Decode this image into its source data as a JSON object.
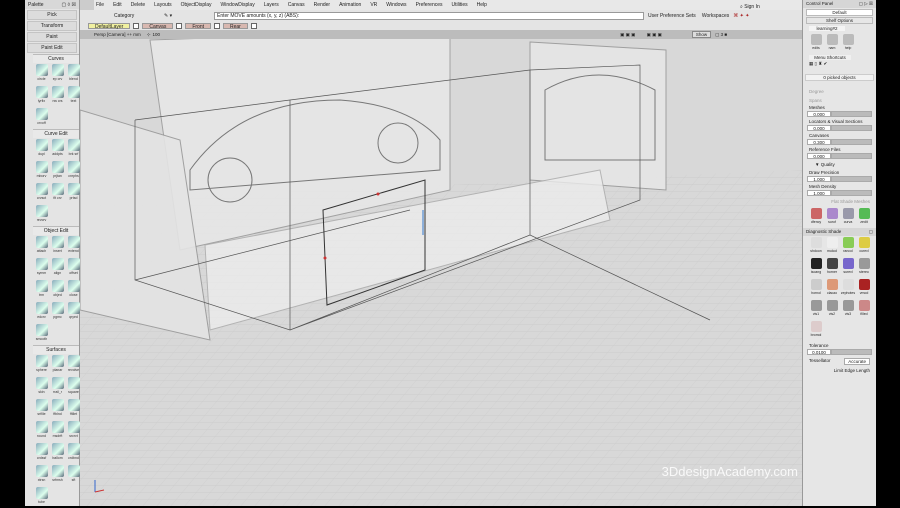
{
  "menu": [
    "File",
    "Edit",
    "Delete",
    "Layouts",
    "ObjectDisplay",
    "WindowDisplay",
    "Layers",
    "Canvas",
    "Render",
    "Animation",
    "VR",
    "Windows",
    "Preferences",
    "Utilities",
    "Help"
  ],
  "toolbar": {
    "category": "Category",
    "prompt": "Enter MOVE amounts (x, y, z) (ABS):",
    "user_pref": "User Preference Sets",
    "workspaces": "Workspaces",
    "sign_in": "Sign In",
    "move_label": "move"
  },
  "layers": [
    "DefaultLayer",
    "Canvas",
    "Front",
    "Rear"
  ],
  "viewport": {
    "label": "Persp [Camera]  ++ mm",
    "zoom": "100",
    "show": "Show",
    "watermark": "3DdesignAcademy.com"
  },
  "palette": {
    "title": "Palette",
    "buttons": [
      "Pick",
      "Transform",
      "Paint",
      "Paint Edit"
    ],
    "sections": [
      {
        "title": "Curves",
        "tools": [
          "circle",
          "ep crv",
          "blend",
          "lyrfix",
          "nw crs",
          "text",
          " crvoff"
        ]
      },
      {
        "title": "Curve Edit",
        "tools": [
          "dupl",
          "addpts",
          "brk srf",
          "mborv",
          "prjtan",
          "cnrphs",
          "crvsct",
          "fit crv",
          "prtsd",
          "revcrv"
        ]
      },
      {
        "title": "Object Edit",
        "tools": [
          "attach",
          "insert",
          "extend",
          "symm",
          "align",
          "offset",
          "trm",
          "objed",
          "close",
          "edcrv",
          "pgmc",
          "qryed",
          "smooth"
        ]
      },
      {
        "title": "Surfaces",
        "tools": [
          "sphere",
          "planar",
          "revolve",
          "skin",
          "rrail_r",
          "square",
          "srfille",
          "ffblnd",
          "ffillet",
          "round",
          "msdrft",
          "srcrvt",
          "crdssf",
          "ballom",
          "crdbnd",
          "xtrsn",
          "srfmsh",
          "sft",
          "tube"
        ]
      }
    ]
  },
  "control_panel": {
    "title": "Control Panel",
    "default": "Default",
    "shelf_options": "Shelf Options",
    "shelf_tab": "learning#2",
    "shelf_icons": [
      "edits",
      "nam",
      "help"
    ],
    "menu_shortcuts": "Menu Shortcuts",
    "picked": "0 picked objects",
    "degree": "Degree",
    "spans": "Spans",
    "fields": [
      {
        "label": "Meshes",
        "value": "0.000"
      },
      {
        "label": "Locators & Visual Sections",
        "value": "0.000"
      },
      {
        "label": "Canvases",
        "value": "0.300"
      },
      {
        "label": "Reference Files",
        "value": "0.000"
      }
    ],
    "quality": "Quality",
    "quality_fields": [
      {
        "label": "Draw Precision",
        "value": "1.000"
      },
      {
        "label": "Mesh Density",
        "value": "1.000"
      }
    ],
    "flat_shade": "Flat Shade Meshes",
    "tools2": [
      "dfency",
      "surof",
      "curva",
      "zedit"
    ],
    "diag_title": "Diagnostic Shade",
    "diag": [
      "shdoon",
      "mulcol",
      "rancol",
      "curevl",
      "isoang",
      "horner",
      "surevl",
      "stereo",
      "hornol",
      "clacao",
      "zephotes",
      "vmod",
      "vis1",
      "vis2",
      "vis3",
      "filled",
      "bromol"
    ],
    "tolerance": "Tolerance",
    "tolerance_value": "0.0100",
    "tessellator": "Tessellator",
    "tessellator_value": "Accurate",
    "limit_edge": "Limit Edge Length"
  },
  "colors": {
    "layer_default": "#f0f0a0",
    "layer_other": "#d8b8b0",
    "viewport": "#d6d6d6"
  }
}
